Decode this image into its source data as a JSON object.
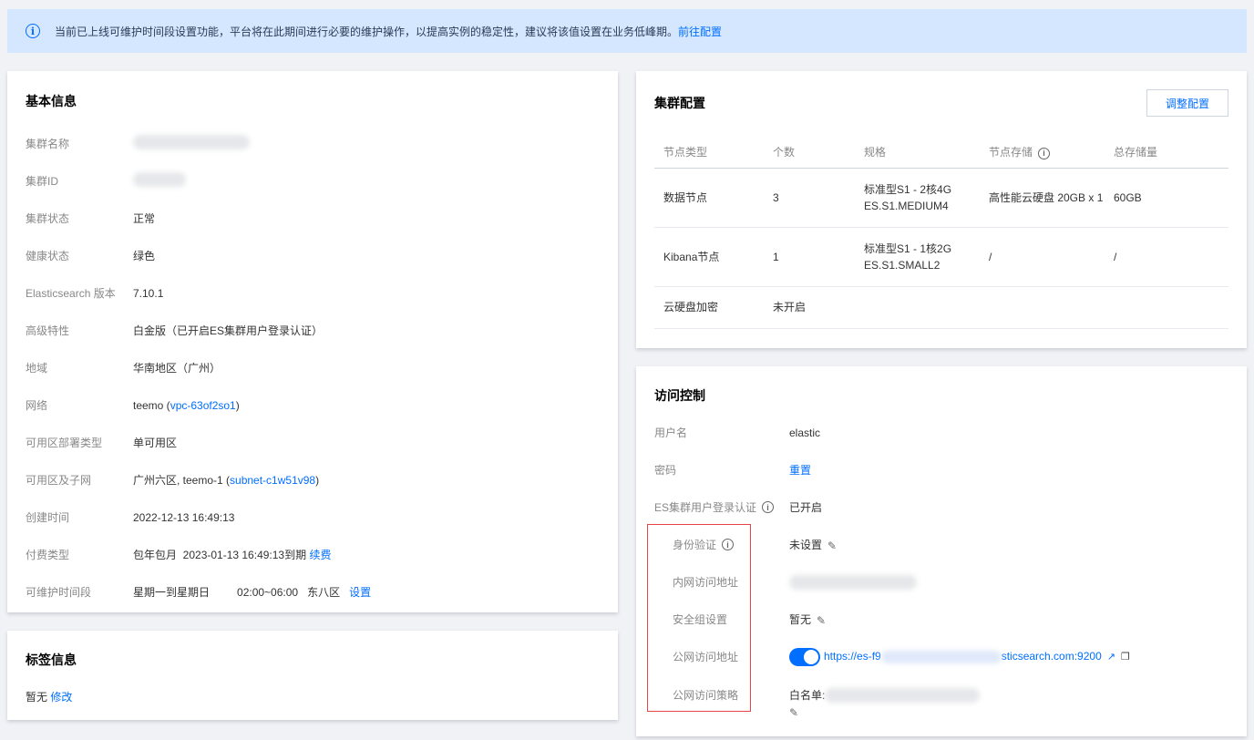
{
  "notice": {
    "text": "当前已上线可维护时间段设置功能，平台将在此期间进行必要的维护操作，以提高实例的稳定性，建议将该值设置在业务低峰期。",
    "link": "前往配置"
  },
  "basic": {
    "title": "基本信息",
    "name_label": "集群名称",
    "id_label": "集群ID",
    "status_label": "集群状态",
    "status_value": "正常",
    "health_label": "健康状态",
    "health_value": "绿色",
    "version_label": "Elasticsearch 版本",
    "version_value": "7.10.1",
    "feature_label": "高级特性",
    "feature_value": "白金版（已开启ES集群用户登录认证）",
    "region_label": "地域",
    "region_value": "华南地区（广州）",
    "network_label": "网络",
    "network_name": "teemo (",
    "network_vpc": "vpc-63of2so1",
    "network_close": ")",
    "deploy_label": "可用区部署类型",
    "deploy_value": "单可用区",
    "zone_label": "可用区及子网",
    "zone_name": "广州六区, teemo-1 (",
    "zone_subnet": "subnet-c1w51v98",
    "zone_close": ")",
    "created_label": "创建时间",
    "created_value": "2022-12-13 16:49:13",
    "billing_label": "付费类型",
    "billing_value": "包年包月  2023-01-13 16:49:13到期",
    "billing_renew": "续费",
    "maint_label": "可维护时间段",
    "maint_days": "星期一到星期日",
    "maint_time": "02:00~06:00",
    "maint_zone": "东八区",
    "maint_set": "设置"
  },
  "tags": {
    "title": "标签信息",
    "value": "暂无",
    "edit": "修改"
  },
  "cluster": {
    "title": "集群配置",
    "adjust_button": "调整配置",
    "headers": [
      "节点类型",
      "个数",
      "规格",
      "节点存储",
      "总存储量"
    ],
    "rows": [
      {
        "type": "数据节点",
        "count": "3",
        "spec1": "标准型S1 - 2核4G",
        "spec2": "ES.S1.MEDIUM4",
        "storage": "高性能云硬盘 20GB x 1",
        "total": "60GB"
      },
      {
        "type": "Kibana节点",
        "count": "1",
        "spec1": "标准型S1 - 1核2G",
        "spec2": "ES.S1.SMALL2",
        "storage": "/",
        "total": "/"
      }
    ],
    "encrypt_label": "云硬盘加密",
    "encrypt_value": "未开启"
  },
  "access": {
    "title": "访问控制",
    "user_label": "用户名",
    "user_value": "elastic",
    "pwd_label": "密码",
    "pwd_reset": "重置",
    "auth_label": "ES集群用户登录认证",
    "auth_value": "已开启",
    "identity_label": "身份验证",
    "identity_value": "未设置",
    "intranet_label": "内网访问地址",
    "sg_label": "安全组设置",
    "sg_value": "暂无",
    "public_label": "公网访问地址",
    "public_url_start": "https://es-f9",
    "public_url_end": "sticsearch.com:9200",
    "policy_label": "公网访问策略",
    "policy_value": "白名单:"
  }
}
